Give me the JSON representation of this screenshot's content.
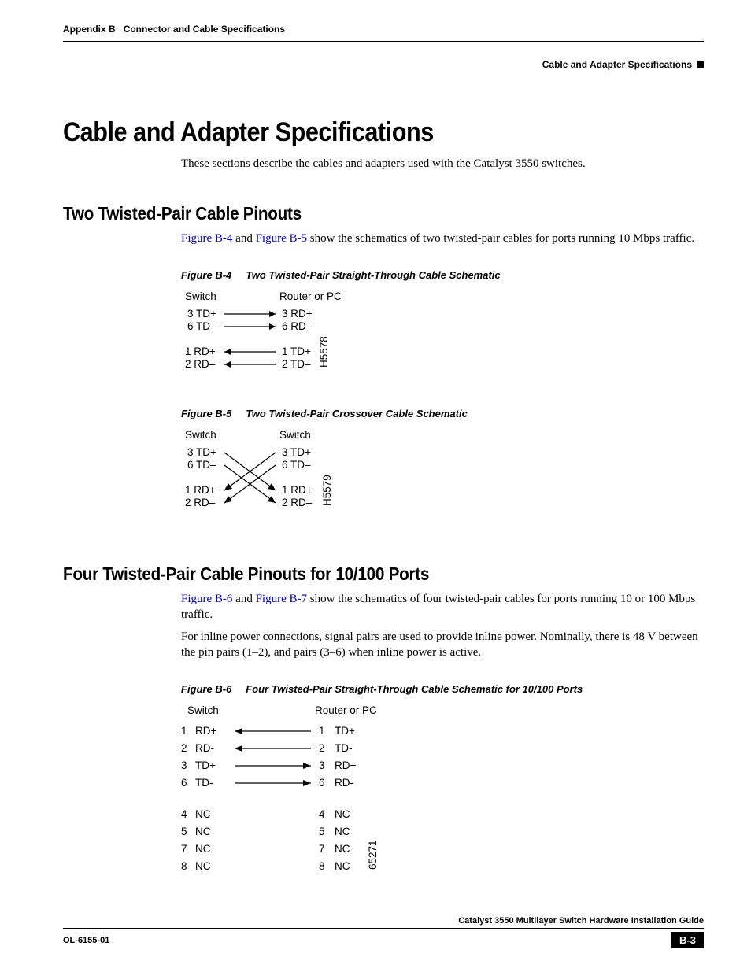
{
  "header": {
    "appendix": "Appendix B",
    "chapter": "Connector and Cable Specifications",
    "section": "Cable and Adapter Specifications"
  },
  "h1": "Cable and Adapter Specifications",
  "intro": "These sections describe the cables and adapters used with the Catalyst 3550 switches.",
  "sec1": {
    "title": "Two Twisted-Pair Cable Pinouts",
    "p1a": "Figure B-4",
    "p1b": " and ",
    "p1c": "Figure B-5",
    "p1d": " show the schematics of two twisted-pair cables for ports running 10 Mbps traffic."
  },
  "figB4": {
    "num": "Figure B-4",
    "title": "Two Twisted-Pair Straight-Through Cable Schematic",
    "leftHead": "Switch",
    "rightHead": "Router or PC",
    "pairs": [
      {
        "l": "3 TD+",
        "r": "3 RD+"
      },
      {
        "l": "6 TD–",
        "r": "6 RD–"
      },
      {
        "l": "1 RD+",
        "r": "1 TD+"
      },
      {
        "l": "2 RD–",
        "r": "2 TD–"
      }
    ],
    "id": "H5578"
  },
  "figB5": {
    "num": "Figure B-5",
    "title": "Two Twisted-Pair Crossover Cable Schematic",
    "leftHead": "Switch",
    "rightHead": "Switch",
    "pairs": [
      {
        "l": "3 TD+",
        "r": "3 TD+"
      },
      {
        "l": "6 TD–",
        "r": "6 TD–"
      },
      {
        "l": "1 RD+",
        "r": "1 RD+"
      },
      {
        "l": "2 RD–",
        "r": "2 RD–"
      }
    ],
    "id": "H5579"
  },
  "sec2": {
    "title": "Four Twisted-Pair Cable Pinouts for 10/100 Ports",
    "p1a": "Figure B-6",
    "p1b": " and ",
    "p1c": "Figure B-7",
    "p1d": " show the schematics of four twisted-pair cables for ports running 10 or 100 Mbps traffic.",
    "p2": "For inline power connections, signal pairs are used to provide inline power. Nominally, there is 48 V between the pin pairs (1–2), and pairs (3–6) when inline power is active."
  },
  "figB6": {
    "num": "Figure B-6",
    "title": "Four Twisted-Pair Straight-Through Cable Schematic for 10/100 Ports",
    "leftHead": "Switch",
    "rightHead": "Router or PC",
    "rows": [
      {
        "ln": "1",
        "ls": "RD+",
        "rn": "1",
        "rs": "TD+",
        "dir": "left"
      },
      {
        "ln": "2",
        "ls": "RD-",
        "rn": "2",
        "rs": "TD-",
        "dir": "left"
      },
      {
        "ln": "3",
        "ls": "TD+",
        "rn": "3",
        "rs": "RD+",
        "dir": "right"
      },
      {
        "ln": "6",
        "ls": "TD-",
        "rn": "6",
        "rs": "RD-",
        "dir": "right"
      }
    ],
    "nc": [
      {
        "ln": "4",
        "ls": "NC",
        "rn": "4",
        "rs": "NC"
      },
      {
        "ln": "5",
        "ls": "NC",
        "rn": "5",
        "rs": "NC"
      },
      {
        "ln": "7",
        "ls": "NC",
        "rn": "7",
        "rs": "NC"
      },
      {
        "ln": "8",
        "ls": "NC",
        "rn": "8",
        "rs": "NC"
      }
    ],
    "id": "65271"
  },
  "footer": {
    "guide": "Catalyst 3550 Multilayer Switch Hardware Installation Guide",
    "docnum": "OL-6155-01",
    "pagenum": "B-3"
  }
}
